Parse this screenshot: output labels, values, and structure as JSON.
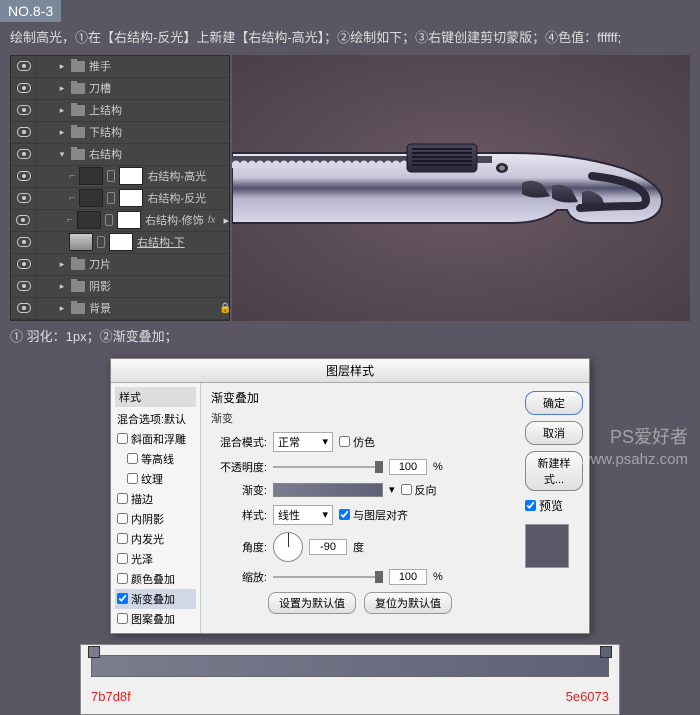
{
  "step": "NO.8-3",
  "instruction1": "绘制高光，①在【右结构-反光】上新建【右结构-高光】；②绘制如下；③右键创建剪切蒙版；④色值：ffffff;",
  "instruction2": "① 羽化：1px；②渐变叠加；",
  "layers": [
    {
      "name": "推手",
      "type": "folder",
      "indent": 0,
      "expanded": false,
      "visible": true
    },
    {
      "name": "刀槽",
      "type": "folder",
      "indent": 0,
      "expanded": false,
      "visible": true
    },
    {
      "name": "上结构",
      "type": "folder",
      "indent": 0,
      "expanded": false,
      "visible": true
    },
    {
      "name": "下结构",
      "type": "folder",
      "indent": 0,
      "expanded": false,
      "visible": true
    },
    {
      "name": "右结构",
      "type": "folder",
      "indent": 0,
      "expanded": true,
      "visible": true
    },
    {
      "name": "右结构-高光",
      "type": "layer",
      "indent": 1,
      "visible": true,
      "thumb": "dark",
      "clip": true
    },
    {
      "name": "右结构-反光",
      "type": "layer",
      "indent": 1,
      "visible": true,
      "thumb": "dark",
      "clip": true
    },
    {
      "name": "右结构-修饰",
      "type": "layer",
      "indent": 1,
      "visible": true,
      "thumb": "dark",
      "clip": true,
      "fx": true
    },
    {
      "name": "右结构-下",
      "type": "layer",
      "indent": 1,
      "visible": true,
      "thumb": "grad",
      "underline": true
    },
    {
      "name": "刀片",
      "type": "folder",
      "indent": 0,
      "expanded": false,
      "visible": true
    },
    {
      "name": "阴影",
      "type": "folder",
      "indent": 0,
      "expanded": false,
      "visible": true
    },
    {
      "name": "背景",
      "type": "folder",
      "indent": 0,
      "expanded": false,
      "visible": true,
      "locked": true
    }
  ],
  "dialog": {
    "title": "图层样式",
    "styleListHeader": "样式",
    "blendOptionsDefault": "混合选项:默认",
    "styles": [
      {
        "label": "斜面和浮雕",
        "checked": false
      },
      {
        "label": "等高线",
        "checked": false,
        "sub": true
      },
      {
        "label": "纹理",
        "checked": false,
        "sub": true
      },
      {
        "label": "描边",
        "checked": false
      },
      {
        "label": "内阴影",
        "checked": false
      },
      {
        "label": "内发光",
        "checked": false
      },
      {
        "label": "光泽",
        "checked": false
      },
      {
        "label": "颜色叠加",
        "checked": false
      },
      {
        "label": "渐变叠加",
        "checked": true,
        "highlight": true
      },
      {
        "label": "图案叠加",
        "checked": false
      }
    ],
    "section": {
      "title": "渐变叠加",
      "sub": "渐变"
    },
    "rows": {
      "blendMode": {
        "label": "混合模式:",
        "value": "正常",
        "dither": "仿色"
      },
      "opacity": {
        "label": "不透明度:",
        "value": "100",
        "unit": "%"
      },
      "gradient": {
        "label": "渐变:",
        "reverse": "反向"
      },
      "style": {
        "label": "样式:",
        "value": "线性",
        "align": "与图层对齐"
      },
      "angle": {
        "label": "角度:",
        "value": "-90",
        "unit": "度"
      },
      "scale": {
        "label": "缩放:",
        "value": "100",
        "unit": "%"
      }
    },
    "bottomBtns": {
      "setDefault": "设置为默认值",
      "resetDefault": "复位为默认值"
    },
    "buttons": {
      "ok": "确定",
      "cancel": "取消",
      "newStyle": "新建样式...",
      "preview": "预览"
    }
  },
  "gradStops": {
    "left": "7b7d8f",
    "right": "5e6073"
  },
  "watermark": {
    "cn": "PS爱好者",
    "url": "www.psahz.com"
  },
  "fx": "fx",
  "chevDown": "▾",
  "chevRight": "▸"
}
